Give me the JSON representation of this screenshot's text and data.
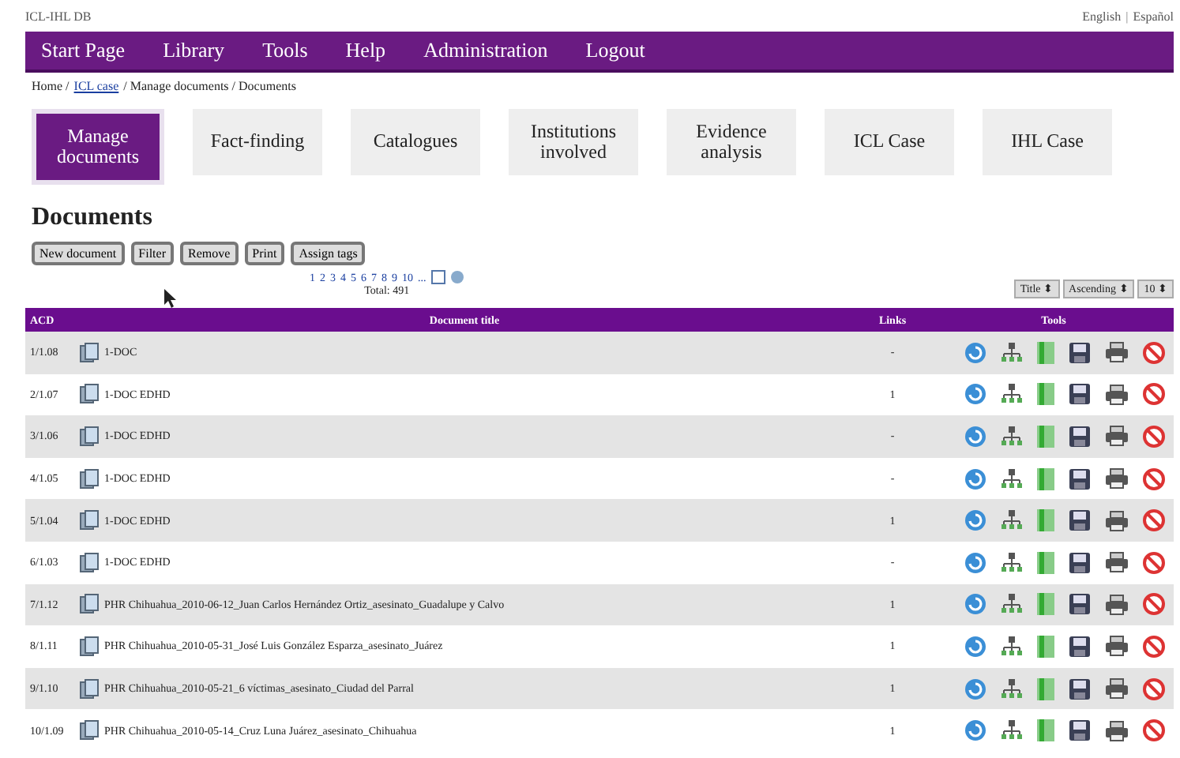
{
  "header": {
    "site_label": "ICL-IHL DB",
    "languages": [
      "English",
      "|",
      "Español"
    ]
  },
  "nav": [
    "Start Page",
    "Library",
    "Tools",
    "Help",
    "Administration",
    "Logout"
  ],
  "breadcrumb": [
    {
      "text": "Home /",
      "link": false
    },
    {
      "text": "ICL case",
      "link": true
    },
    {
      "text": "/ Manage documents / Documents",
      "link": false
    }
  ],
  "tabs": [
    {
      "label": "Manage documents",
      "selected": true
    },
    {
      "label": "Fact-finding",
      "selected": false
    },
    {
      "label": "Catalogues",
      "selected": false
    },
    {
      "label": "Institutions involved",
      "selected": false
    },
    {
      "label": "Evidence analysis",
      "selected": false
    },
    {
      "label": "ICL Case",
      "selected": false
    },
    {
      "label": "IHL Case",
      "selected": false
    }
  ],
  "heading": "Documents",
  "buttons": [
    "New document",
    "Filter",
    "Remove",
    "Print",
    "Assign tags"
  ],
  "pagination": {
    "pages": [
      "1",
      "2",
      "3",
      "4",
      "5",
      "6",
      "7",
      "8",
      "9",
      "10"
    ],
    "more": "...",
    "total": "Total: 491"
  },
  "sort": [
    {
      "label": "Title",
      "arrow": "⬍"
    },
    {
      "label": "Ascending",
      "arrow": "⬍"
    },
    {
      "label": "10",
      "arrow": "⬍"
    }
  ],
  "table": {
    "columns": [
      "ACD",
      "Document title",
      "Links",
      "Tools"
    ],
    "rows": [
      {
        "id": "1/1.08",
        "title": "1-DOC",
        "links": "-"
      },
      {
        "id": "2/1.07",
        "title": "1-DOC EDHD",
        "links": "1"
      },
      {
        "id": "3/1.06",
        "title": "1-DOC EDHD",
        "links": "-"
      },
      {
        "id": "4/1.05",
        "title": "1-DOC EDHD",
        "links": "-"
      },
      {
        "id": "5/1.04",
        "title": "1-DOC EDHD",
        "links": "1"
      },
      {
        "id": "6/1.03",
        "title": "1-DOC EDHD",
        "links": "-"
      },
      {
        "id": "7/1.12",
        "title": "PHR Chihuahua_2010-06-12_Juan Carlos Hernández Ortiz_asesinato_Guadalupe y Calvo",
        "links": "1"
      },
      {
        "id": "8/1.11",
        "title": "PHR Chihuahua_2010-05-31_José Luis González Esparza_asesinato_Juárez",
        "links": "1"
      },
      {
        "id": "9/1.10",
        "title": "PHR Chihuahua_2010-05-21_6 víctimas_asesinato_Ciudad del Parral",
        "links": "1"
      },
      {
        "id": "10/1.09",
        "title": "PHR Chihuahua_2010-05-14_Cruz Luna Juárez_asesinato_Chihuahua",
        "links": "1"
      }
    ]
  }
}
